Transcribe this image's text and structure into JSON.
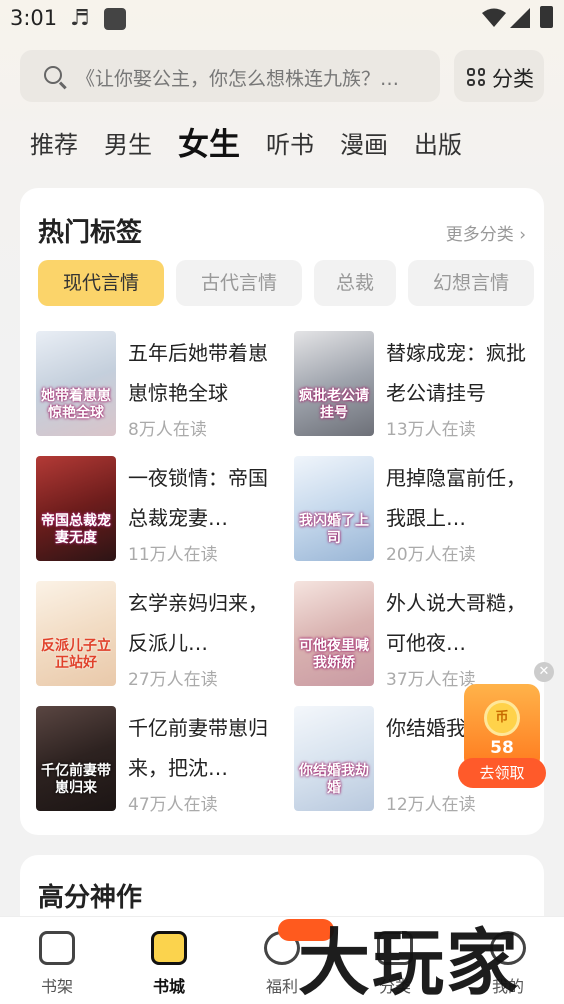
{
  "status_bar": {
    "time": "3:01",
    "music_icon": "♬"
  },
  "search": {
    "placeholder": "《让你娶公主，你怎么想株连九族？…"
  },
  "category_button": {
    "label": "分类"
  },
  "channel_tabs": [
    {
      "label": "推荐",
      "active": false
    },
    {
      "label": "男生",
      "active": false
    },
    {
      "label": "女生",
      "active": true
    },
    {
      "label": "听书",
      "active": false
    },
    {
      "label": "漫画",
      "active": false
    },
    {
      "label": "出版",
      "active": false
    }
  ],
  "hot_tags": {
    "title": "热门标签",
    "more": "更多分类 ›",
    "tags": [
      {
        "label": "现代言情",
        "active": true
      },
      {
        "label": "古代言情",
        "active": false
      },
      {
        "label": "总裁",
        "active": false
      },
      {
        "label": "幻想言情",
        "active": false
      }
    ],
    "books": [
      {
        "title": "五年后她带着崽崽惊艳全球",
        "readers": "8万人在读",
        "cover_text": "她带着崽崽惊艳全球",
        "cover_color": "#cfd9e6"
      },
      {
        "title": "替嫁成宠：疯批老公请挂号",
        "readers": "13万人在读",
        "cover_text": "疯批老公请挂号",
        "cover_color": "#b9bdc4"
      },
      {
        "title": "一夜锁情：帝国总裁宠妻…",
        "readers": "11万人在读",
        "cover_text": "帝国总裁宠妻无度",
        "cover_color": "#8e2e2c"
      },
      {
        "title": "甩掉隐富前任，我跟上…",
        "readers": "20万人在读",
        "cover_text": "我闪婚了上司",
        "cover_color": "#cfe0f0"
      },
      {
        "title": "玄学亲妈归来，反派儿…",
        "readers": "27万人在读",
        "cover_text": "反派儿子立正站好",
        "cover_color": "#f5e6d6"
      },
      {
        "title": "外人说大哥糙，可他夜…",
        "readers": "37万人在读",
        "cover_text": "可他夜里喊我娇娇",
        "cover_color": "#ead2d0"
      },
      {
        "title": "千亿前妻带崽归来，把沈…",
        "readers": "47万人在读",
        "cover_text": "千亿前妻带崽归来",
        "cover_color": "#3a3130"
      },
      {
        "title": "你结婚我劫婚",
        "readers": "12万人在读",
        "cover_text": "你结婚我劫婚",
        "cover_color": "#dfe8f3"
      }
    ]
  },
  "reward": {
    "coins": "58",
    "button": "去领取",
    "coin_symbol": "币"
  },
  "section2": {
    "title": "高分神作"
  },
  "bottom_nav": [
    {
      "label": "书架",
      "icon": "bookshelf-icon",
      "active": false
    },
    {
      "label": "书城",
      "icon": "bookstore-icon",
      "active": true
    },
    {
      "label": "福利",
      "icon": "gift-icon",
      "active": false
    },
    {
      "label": "分类",
      "icon": "category-icon",
      "active": false
    },
    {
      "label": "我的",
      "icon": "profile-icon",
      "active": false
    }
  ],
  "watermark": "大玩家",
  "colors": {
    "accent": "#fbd46a",
    "reward": "#ff7a1e"
  }
}
